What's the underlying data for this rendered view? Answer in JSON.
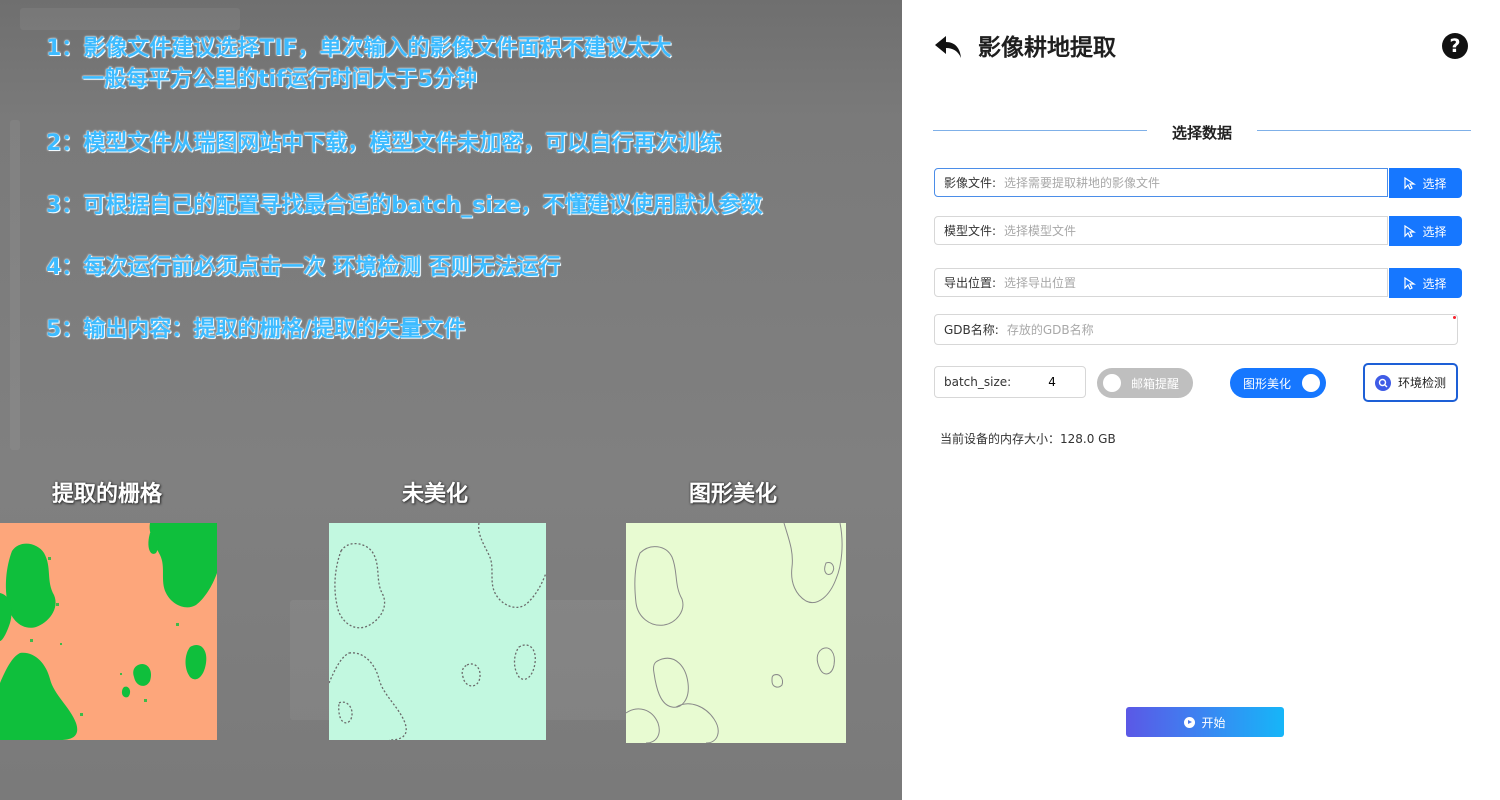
{
  "overlay": {
    "tips": [
      "1：影像文件建议选择TIF，单次输入的影像文件面积不建议太大",
      "一般每平方公里的tif运行时间大于5分钟",
      "2：模型文件从瑞图网站中下载，模型文件未加密，可以自行再次训练",
      "3：可根据自己的配置寻找最合适的batch_size，不懂建议使用默认参数",
      "4：每次运行前必须点击一次 环境检测 否则无法运行",
      "5：输出内容：提取的栅格/提取的矢量文件"
    ],
    "captions": [
      "提取的栅格",
      "未美化",
      "图形美化"
    ],
    "colors": {
      "tip_text": "#3dbbff",
      "raster_bg": "#fda67b",
      "raster_fg": "#0fbf3c",
      "unrefined_bg": "#c2f8e0",
      "refined_bg": "#e8fbd2"
    }
  },
  "dialog": {
    "title": "影像耕地提取",
    "help_glyph": "?",
    "section_title": "选择数据",
    "image_file": {
      "label": "影像文件:",
      "placeholder": "选择需要提取耕地的影像文件",
      "button": "选择"
    },
    "model_file": {
      "label": "模型文件:",
      "placeholder": "选择模型文件",
      "button": "选择"
    },
    "export_path": {
      "label": "导出位置:",
      "placeholder": "选择导出位置",
      "button": "选择"
    },
    "gdb_name": {
      "label": "GDB名称:",
      "placeholder": "存放的GDB名称"
    },
    "batch_size": {
      "label": "batch_size:",
      "value": "4"
    },
    "email_toggle": {
      "label": "邮箱提醒",
      "on": false
    },
    "beautify_toggle": {
      "label": "图形美化",
      "on": true
    },
    "env_check": {
      "label": "环境检测"
    },
    "memory": {
      "label": "当前设备的内存大小：128.0 GB"
    },
    "start": {
      "label": "开始"
    },
    "colors": {
      "primary": "#1677ff",
      "divider": "#7fb0e8"
    }
  }
}
